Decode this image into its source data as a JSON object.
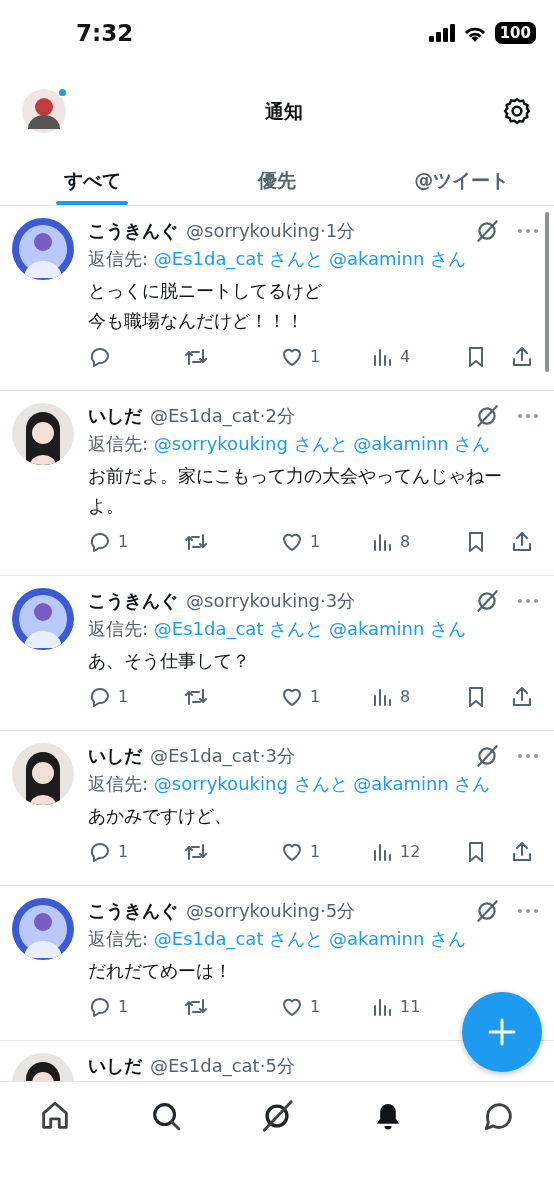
{
  "status_bar": {
    "time": "7:32",
    "battery": "100"
  },
  "header": {
    "title": "通知",
    "unread_dot": true
  },
  "tabs": [
    {
      "label": "すべて",
      "selected": true
    },
    {
      "label": "優先",
      "selected": false
    },
    {
      "label": "@ツイート",
      "selected": false
    }
  ],
  "tweets": [
    {
      "name": "こうきんぐ",
      "handle": "@sorrykouking",
      "time": "·1分",
      "reply_label": "返信先:",
      "reply_to": "@Es1da_cat さんと @akaminn さん",
      "body": [
        "とっくに脱ニートしてるけど",
        "今も職場なんだけど！！！"
      ],
      "likes": "1",
      "views": "4"
    },
    {
      "name": "いしだ",
      "handle": "@Es1da_cat",
      "time": "·2分",
      "reply_label": "返信先:",
      "reply_to": "@sorrykouking さんと @akaminn さん",
      "body": [
        "お前だよ。家にこもって力の大会やってんじゃねーよ。"
      ],
      "replies": "1",
      "likes": "1",
      "views": "8"
    },
    {
      "name": "こうきんぐ",
      "handle": "@sorrykouking",
      "time": "·3分",
      "reply_label": "返信先:",
      "reply_to": "@Es1da_cat さんと @akaminn さん",
      "body": [
        "あ、そう仕事して？"
      ],
      "replies": "1",
      "likes": "1",
      "views": "8"
    },
    {
      "name": "いしだ",
      "handle": "@Es1da_cat",
      "time": "·3分",
      "reply_label": "返信先:",
      "reply_to": "@sorrykouking さんと @akaminn さん",
      "body": [
        "あかみですけど、"
      ],
      "replies": "1",
      "likes": "1",
      "views": "12"
    },
    {
      "name": "こうきんぐ",
      "handle": "@sorrykouking",
      "time": "·5分",
      "reply_label": "返信先:",
      "reply_to": "@Es1da_cat さんと @akaminn さん",
      "body": [
        "だれだてめーは！"
      ],
      "replies": "1",
      "likes": "1",
      "views": "11"
    },
    {
      "name": "いしだ",
      "handle": "@Es1da_cat",
      "time": "·5分"
    }
  ],
  "bottom_nav": [
    {
      "kind": "home",
      "selected": false
    },
    {
      "kind": "search",
      "selected": false
    },
    {
      "kind": "grok",
      "selected": false
    },
    {
      "kind": "notifications",
      "selected": true
    },
    {
      "kind": "messages",
      "selected": false
    }
  ]
}
